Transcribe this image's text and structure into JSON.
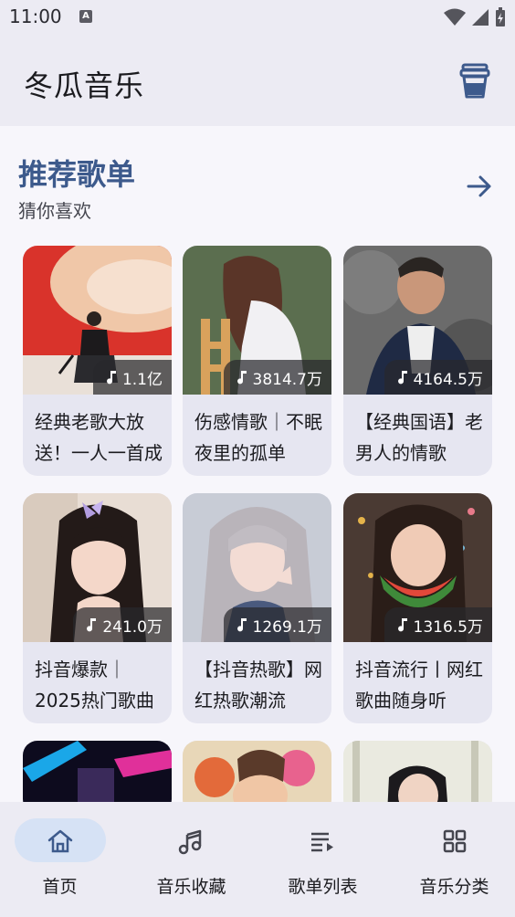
{
  "status_bar": {
    "time": "11:00",
    "a_badge": "A"
  },
  "app": {
    "title": "冬瓜音乐",
    "cup_icon": "cup-icon"
  },
  "section": {
    "title": "推荐歌单",
    "subtitle": "猜你喜欢",
    "more_icon": "arrow-right-icon"
  },
  "playlists": [
    {
      "count": "1.1亿",
      "title": "经典老歌大放送！一人一首成名曲"
    },
    {
      "count": "3814.7万",
      "title": "伤感情歌｜不眠夜里的孤单"
    },
    {
      "count": "4164.5万",
      "title": "【经典国语】老男人的情歌"
    },
    {
      "count": "241.0万",
      "title": "抖音爆款｜2025热门歌曲"
    },
    {
      "count": "1269.1万",
      "title": "【抖音热歌】网红热歌潮流"
    },
    {
      "count": "1316.5万",
      "title": "抖音流行丨网红歌曲随身听"
    }
  ],
  "nav": [
    {
      "label": "首页",
      "icon": "home-icon",
      "active": true
    },
    {
      "label": "音乐收藏",
      "icon": "music-note-icon"
    },
    {
      "label": "歌单列表",
      "icon": "playlist-icon"
    },
    {
      "label": "音乐分类",
      "icon": "grid-icon"
    }
  ],
  "colors": {
    "accent": "#3d5a8c",
    "nav_active_bg": "#d6e2f5",
    "bar_bg": "#ecebf3"
  }
}
